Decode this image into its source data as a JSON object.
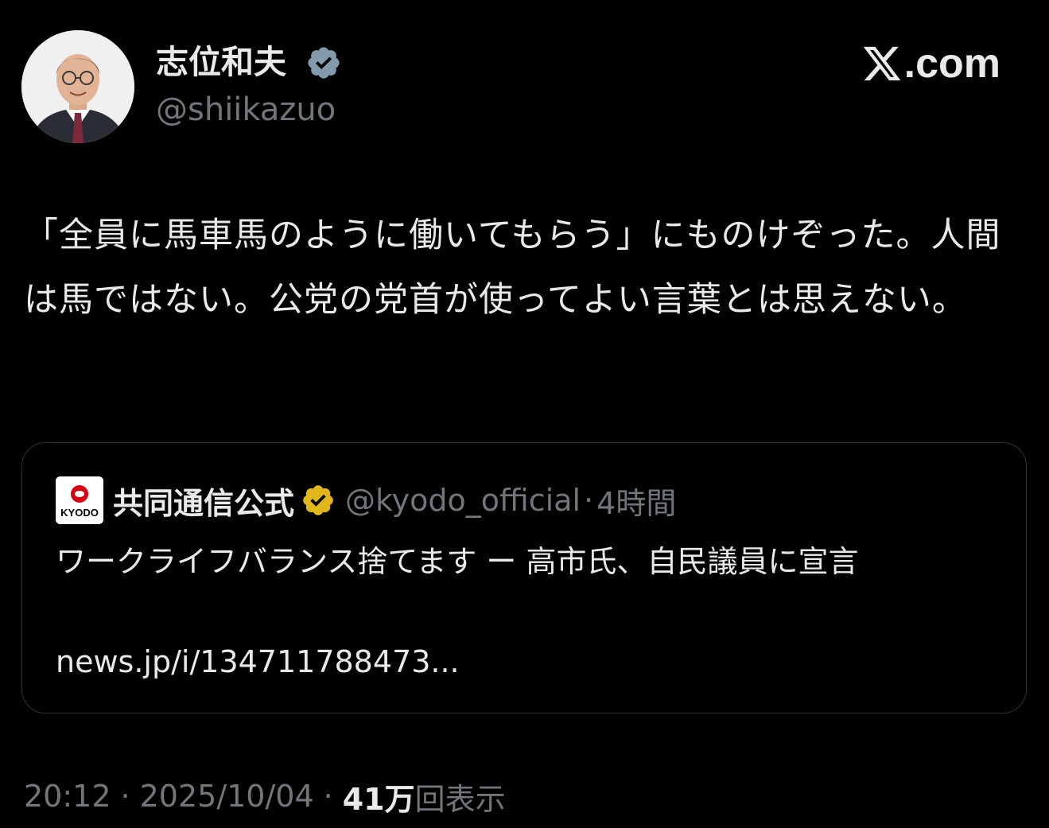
{
  "author": {
    "name": "志位和夫",
    "handle": "@shiikazuo",
    "verified_color": "#829aab"
  },
  "site": {
    "domain": ".com"
  },
  "tweet": {
    "text": "「全員に馬車馬のように働いてもらう」にものけぞった。人間は馬ではない。公党の党首が使ってよい言葉とは思えない。"
  },
  "quote": {
    "logo_text": "KYODO",
    "name": "共同通信公式",
    "handle": "@kyodo_official",
    "separator": "·",
    "time": "4時間",
    "text": "ワークライフバランス捨てます ー 高市氏、自民議員に宣言",
    "link": "news.jp/i/134711788473...",
    "verified_color": "#e2b719"
  },
  "meta": {
    "time": "20:12",
    "separator": "·",
    "date": "2025/10/04",
    "views_count": "41万",
    "views_label": "回表示"
  },
  "colors": {
    "background": "#000000",
    "text_primary": "#e7e9ea",
    "text_secondary": "#71767b",
    "border": "#2f3336",
    "kyodo_red": "#d7000f"
  }
}
